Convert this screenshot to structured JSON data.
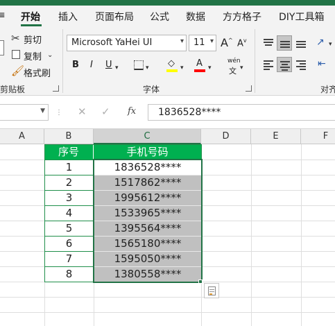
{
  "tabs": [
    "开始",
    "插入",
    "页面布局",
    "公式",
    "数据",
    "方方格子",
    "DIY工具箱"
  ],
  "ribbon": {
    "clipboard": {
      "cut": "剪切",
      "copy": "复制",
      "format_painter": "格式刷",
      "group_label": "剪贴板"
    },
    "font": {
      "font_name": "Microsoft YaHei UI",
      "font_size": "11",
      "bold": "B",
      "italic": "I",
      "underline": "U",
      "phonetic": "wén",
      "grow": "A",
      "shrink": "A",
      "group_label": "字体"
    },
    "alignment": {
      "group_label": "对齐"
    }
  },
  "formula_bar": {
    "value": "1836528****",
    "fx": "fx"
  },
  "columns": [
    "A",
    "B",
    "C",
    "D",
    "E",
    "F"
  ],
  "table": {
    "headers": [
      "序号",
      "手机号码"
    ],
    "rows": [
      [
        "1",
        "1836528****"
      ],
      [
        "2",
        "1517862****"
      ],
      [
        "3",
        "1995612****"
      ],
      [
        "4",
        "1533965****"
      ],
      [
        "5",
        "1395564****"
      ],
      [
        "6",
        "1565180****"
      ],
      [
        "7",
        "1595050****"
      ],
      [
        "8",
        "1380558****"
      ]
    ]
  },
  "colors": {
    "excel_green": "#217346",
    "header_fill": "#00b050",
    "selection_fill": "#c0c0c0"
  }
}
